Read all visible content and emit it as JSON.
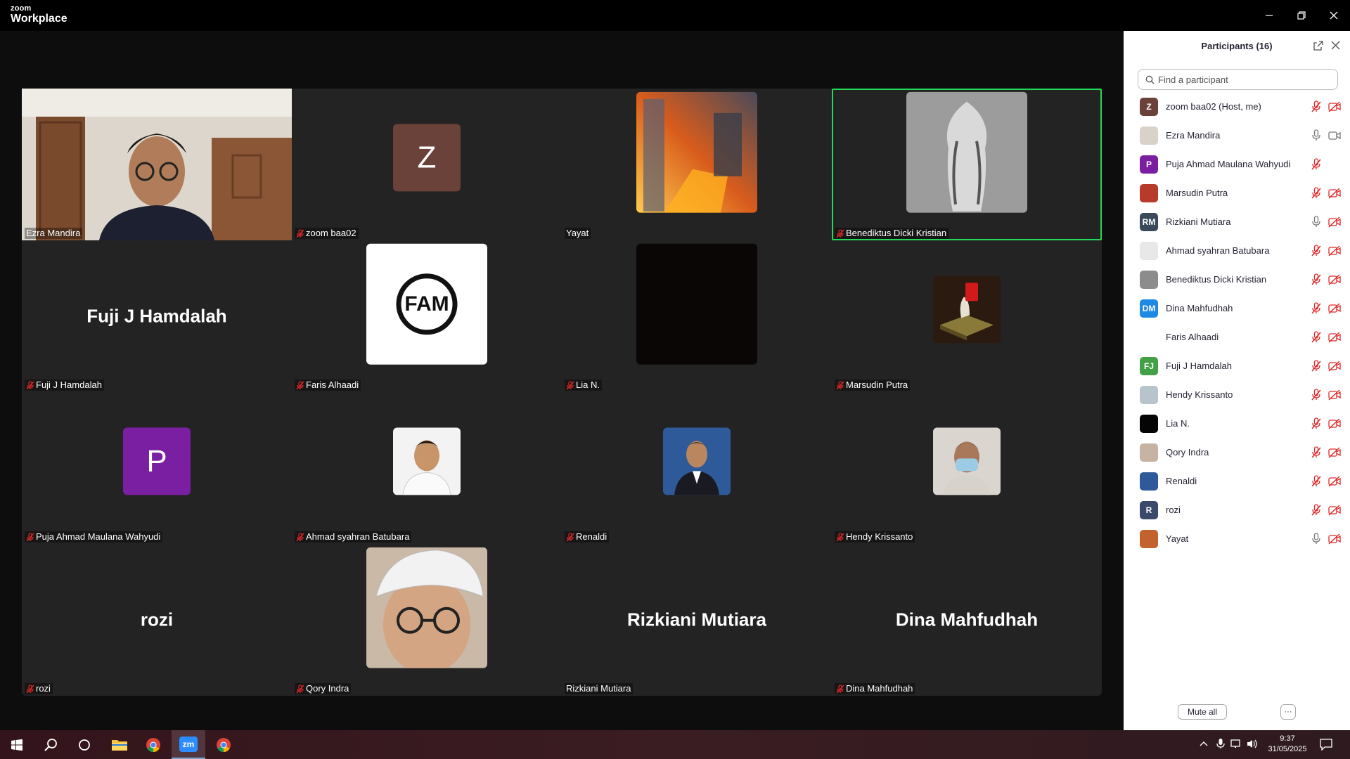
{
  "app": {
    "brand_top": "zoom",
    "brand_bottom": "Workplace"
  },
  "tiles": [
    {
      "name": "Ezra Mandira",
      "muted": false
    },
    {
      "name": "zoom baa02",
      "muted": true,
      "avatar_letter": "Z"
    },
    {
      "name": "Yayat",
      "muted": false
    },
    {
      "name": "Benediktus Dicki Kristian",
      "muted": true,
      "active_speaker": true
    },
    {
      "name": "Fuji J Hamdalah",
      "muted": true,
      "big_name": "Fuji J Hamdalah"
    },
    {
      "name": "Faris Alhaadi",
      "muted": true,
      "logo_text": "FAM"
    },
    {
      "name": "Lia N.",
      "muted": true
    },
    {
      "name": "Marsudin Putra",
      "muted": true
    },
    {
      "name": "Puja Ahmad Maulana Wahyudi",
      "muted": true,
      "avatar_letter": "P"
    },
    {
      "name": "Ahmad syahran Batubara",
      "muted": true
    },
    {
      "name": "Renaldi",
      "muted": true
    },
    {
      "name": "Hendy Krissanto",
      "muted": true
    },
    {
      "name": "rozi",
      "muted": true,
      "big_name": "rozi"
    },
    {
      "name": "Qory Indra",
      "muted": true
    },
    {
      "name": "Rizkiani Mutiara",
      "muted": false,
      "big_name": "Rizkiani Mutiara"
    },
    {
      "name": "Dina Mahfudhah",
      "muted": true,
      "big_name": "Dina Mahfudhah"
    }
  ],
  "panel": {
    "title": "Participants (16)",
    "search_placeholder": "Find a participant",
    "participants": [
      {
        "name": "zoom baa02 (Host, me)",
        "avatar": "Z",
        "avatar_color": "#6b4239",
        "mic": "muted",
        "cam": "off"
      },
      {
        "name": "Ezra Mandira",
        "avatar": "",
        "avatar_color": "#d8d2c8",
        "mic": "on",
        "cam": "on"
      },
      {
        "name": "Puja Ahmad Maulana Wahyudi",
        "avatar": "P",
        "avatar_color": "#7b1fa2",
        "mic": "muted",
        "cam": "none"
      },
      {
        "name": "Marsudin Putra",
        "avatar": "",
        "avatar_color": "#b83a2a",
        "mic": "muted",
        "cam": "off"
      },
      {
        "name": "Rizkiani Mutiara",
        "avatar": "RM",
        "avatar_color": "#3b4a5a",
        "mic": "on",
        "cam": "off"
      },
      {
        "name": "Ahmad syahran Batubara",
        "avatar": "",
        "avatar_color": "#e8e8e8",
        "mic": "muted",
        "cam": "off"
      },
      {
        "name": "Benediktus Dicki Kristian",
        "avatar": "",
        "avatar_color": "#8c8c8c",
        "mic": "muted",
        "cam": "off"
      },
      {
        "name": "Dina Mahfudhah",
        "avatar": "DM",
        "avatar_color": "#1e88e5",
        "mic": "muted",
        "cam": "off"
      },
      {
        "name": "Faris Alhaadi",
        "avatar": "",
        "avatar_color": "#ffffff",
        "mic": "muted",
        "cam": "off"
      },
      {
        "name": "Fuji J Hamdalah",
        "avatar": "FJ",
        "avatar_color": "#43a047",
        "mic": "muted",
        "cam": "off"
      },
      {
        "name": "Hendy Krissanto",
        "avatar": "",
        "avatar_color": "#b8c4cc",
        "mic": "muted",
        "cam": "off"
      },
      {
        "name": "Lia N.",
        "avatar": "",
        "avatar_color": "#050505",
        "mic": "muted",
        "cam": "off"
      },
      {
        "name": "Qory Indra",
        "avatar": "",
        "avatar_color": "#c7b3a3",
        "mic": "muted",
        "cam": "off"
      },
      {
        "name": "Renaldi",
        "avatar": "",
        "avatar_color": "#2f5a9a",
        "mic": "muted",
        "cam": "off"
      },
      {
        "name": "rozi",
        "avatar": "R",
        "avatar_color": "#3b4a6a",
        "mic": "muted",
        "cam": "off"
      },
      {
        "name": "Yayat",
        "avatar": "",
        "avatar_color": "#c4622d",
        "mic": "on",
        "cam": "off"
      }
    ],
    "mute_all_label": "Mute all",
    "more_label": "···"
  },
  "taskbar": {
    "time": "9:37",
    "date": "31/05/2025",
    "zoom_label": "zm"
  },
  "colors": {
    "muted_red": "#e02828",
    "active_speaker": "#23d959"
  }
}
